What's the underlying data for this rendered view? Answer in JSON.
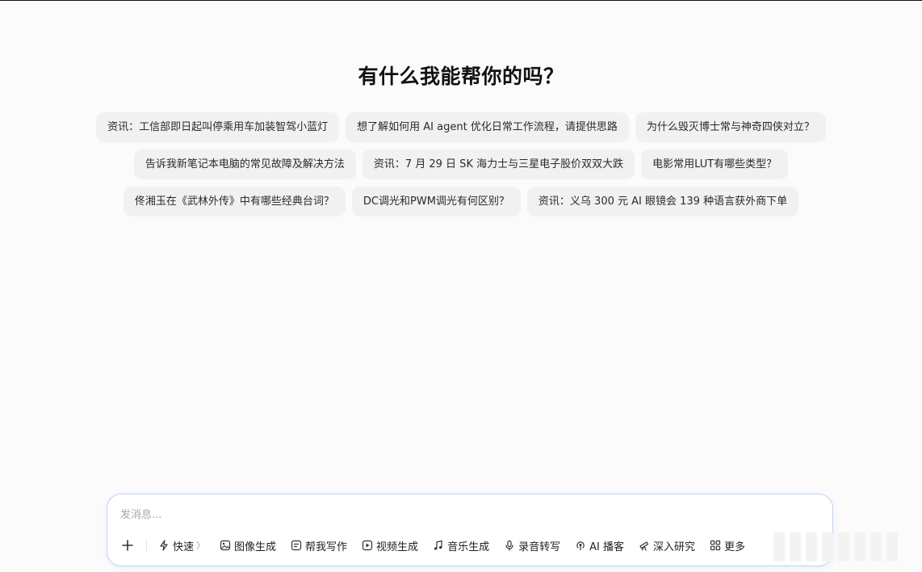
{
  "heading": "有什么我能帮你的吗？",
  "suggestions": [
    [
      "资讯：工信部即日起叫停乘用车加装智驾小蓝灯",
      "想了解如何用 AI agent 优化日常工作流程，请提供思路",
      "为什么毁灭博士常与神奇四侠对立？"
    ],
    [
      "告诉我新笔记本电脑的常见故障及解决方法",
      "资讯：7 月 29 日 SK 海力士与三星电子股价双双大跌",
      "电影常用LUT有哪些类型？"
    ],
    [
      "佟湘玉在《武林外传》中有哪些经典台词？",
      "DC调光和PWM调光有何区别？",
      "资讯：义乌 300 元 AI 眼镜会 139 种语言获外商下单"
    ]
  ],
  "composer": {
    "placeholder": "发消息...",
    "value": ""
  },
  "toolbar": {
    "mode_label": "快速",
    "mode_chevron": "〉",
    "tools": [
      {
        "label": "图像生成",
        "icon": "image-icon"
      },
      {
        "label": "帮我写作",
        "icon": "write-icon"
      },
      {
        "label": "视频生成",
        "icon": "video-icon"
      },
      {
        "label": "音乐生成",
        "icon": "music-icon"
      },
      {
        "label": "录音转写",
        "icon": "mic-icon"
      },
      {
        "label": "AI 播客",
        "icon": "podcast-icon"
      },
      {
        "label": "深入研究",
        "icon": "research-icon"
      },
      {
        "label": "更多",
        "icon": "grid-icon"
      }
    ]
  },
  "colors": {
    "accent_border": "#bcd3f7",
    "chip_bg": "#f1f1f3",
    "page_bg": "#fbfbfc"
  }
}
